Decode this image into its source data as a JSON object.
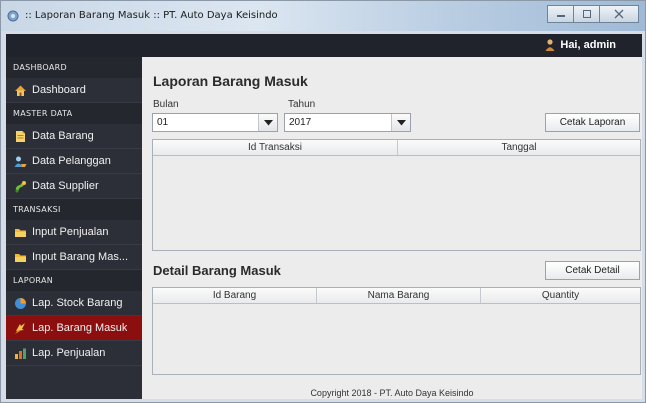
{
  "window": {
    "title": ":: Laporan Barang Masuk :: PT. Auto Daya Keisindo"
  },
  "topbar": {
    "greeting": "Hai, admin"
  },
  "sidebar": {
    "sections": [
      {
        "label": "DASHBOARD",
        "items": [
          {
            "label": "Dashboard",
            "icon": "home-icon"
          }
        ]
      },
      {
        "label": "MASTER DATA",
        "items": [
          {
            "label": "Data Barang",
            "icon": "document-icon"
          },
          {
            "label": "Data Pelanggan",
            "icon": "customer-icon"
          },
          {
            "label": "Data Supplier",
            "icon": "supplier-icon"
          }
        ]
      },
      {
        "label": "TRANSAKSI",
        "items": [
          {
            "label": "Input Penjualan",
            "icon": "folder-icon"
          },
          {
            "label": "Input Barang Mas...",
            "icon": "folder-icon"
          }
        ]
      },
      {
        "label": "LAPORAN",
        "items": [
          {
            "label": "Lap. Stock Barang",
            "icon": "pie-icon"
          },
          {
            "label": "Lap. Barang Masuk",
            "icon": "report-icon",
            "active": true
          },
          {
            "label": "Lap. Penjualan",
            "icon": "bar-chart-icon"
          }
        ]
      }
    ]
  },
  "main": {
    "title": "Laporan Barang Masuk",
    "bulan_label": "Bulan",
    "bulan_value": "01",
    "tahun_label": "Tahun",
    "tahun_value": "2017",
    "cetak_laporan": "Cetak Laporan",
    "table1_headers": [
      "Id Transaksi",
      "Tanggal"
    ],
    "detail_title": "Detail Barang Masuk",
    "cetak_detail": "Cetak Detail",
    "table2_headers": [
      "Id Barang",
      "Nama Barang",
      "Quantity"
    ]
  },
  "footer": {
    "copyright": "Copyright 2018 - PT. Auto Daya Keisindo"
  },
  "colors": {
    "topbar": "#20232b",
    "sidebar": "#2c2f37",
    "active": "#8b0f0f"
  }
}
